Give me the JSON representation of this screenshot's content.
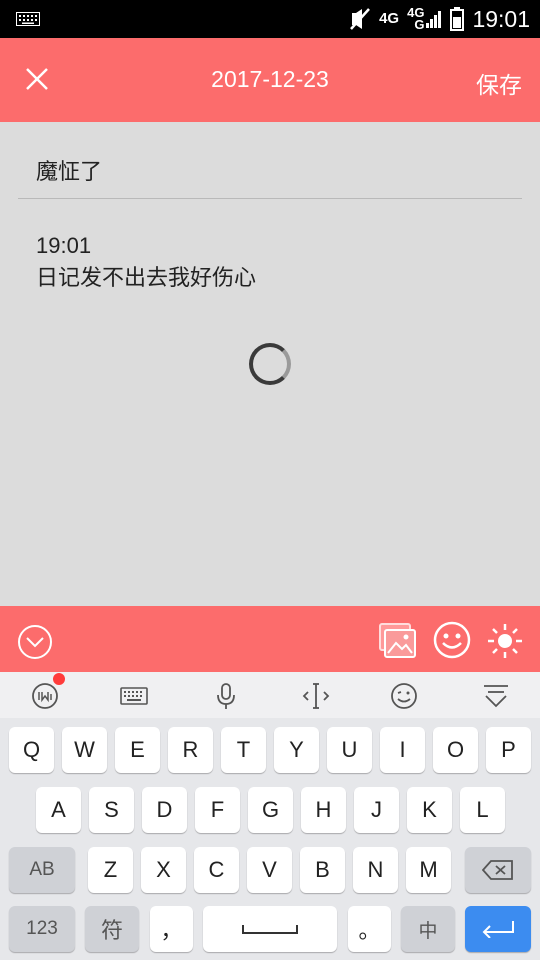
{
  "status_bar": {
    "time": "19:01",
    "network_1": "4G",
    "network_2_top": "4G",
    "network_2_bottom": "G",
    "icons": [
      "keyboard-icon",
      "mute-icon",
      "signal-icon",
      "battery-icon"
    ]
  },
  "header": {
    "date": "2017-12-23",
    "save_label": "保存",
    "close_icon": "close-icon"
  },
  "diary": {
    "title": "魔怔了",
    "time": "19:01",
    "body": "日记发不出去我好伤心"
  },
  "toolbar": {
    "icons": [
      "chevron-down-circle-icon",
      "photo-icon",
      "emoji-icon",
      "weather-sun-icon"
    ]
  },
  "keyboard": {
    "tool_icons": [
      "ime-logo-icon",
      "keyboard-icon",
      "microphone-icon",
      "cursor-move-icon",
      "emoji-icon",
      "hide-keyboard-icon"
    ],
    "row1": [
      "Q",
      "W",
      "E",
      "R",
      "T",
      "Y",
      "U",
      "I",
      "O",
      "P"
    ],
    "row2": [
      "A",
      "S",
      "D",
      "F",
      "G",
      "H",
      "J",
      "K",
      "L"
    ],
    "row3": [
      "Z",
      "X",
      "C",
      "V",
      "B",
      "N",
      "M"
    ],
    "shift_label": "AB",
    "num_label": "123",
    "symbol_label": "符",
    "comma_label": "，",
    "period_label": "。",
    "lang_label": "中"
  },
  "colors": {
    "accent": "#fc6c6c",
    "enter_key": "#3c8cf0",
    "content_bg": "#dcdcdc"
  }
}
